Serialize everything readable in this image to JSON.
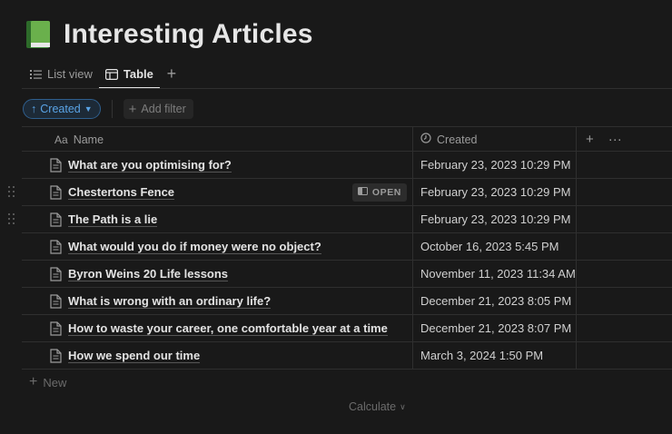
{
  "page": {
    "title": "Interesting Articles",
    "icon": "green-book-icon"
  },
  "tabs": [
    {
      "label": "List view",
      "icon": "list-icon",
      "active": false
    },
    {
      "label": "Table",
      "icon": "table-icon",
      "active": true
    }
  ],
  "filters": {
    "sort_label": "Created",
    "add_filter_label": "Add filter"
  },
  "table": {
    "columns": {
      "name": {
        "label": "Name",
        "icon": "text-aa-icon"
      },
      "created": {
        "label": "Created",
        "icon": "clock-icon"
      }
    },
    "rows": [
      {
        "name": "What are you optimising for?",
        "created": "February 23, 2023 10:29 PM"
      },
      {
        "name": "Chestertons Fence",
        "created": "February 23, 2023 10:29 PM"
      },
      {
        "name": "The Path is a lie",
        "created": "February 23, 2023 10:29 PM"
      },
      {
        "name": "What would you do if money were no object?",
        "created": "October 16, 2023 5:45 PM"
      },
      {
        "name": "Byron Weins 20 Life lessons",
        "created": "November 11, 2023 11:34 AM"
      },
      {
        "name": "What is wrong with an ordinary life?",
        "created": "December 21, 2023 8:05 PM"
      },
      {
        "name": "How to waste your career, one comfortable year at a time",
        "created": "December 21, 2023 8:07 PM"
      },
      {
        "name": "How we spend our time",
        "created": "March 3, 2024 1:50 PM"
      }
    ],
    "open_label": "OPEN",
    "new_label": "New",
    "calculate_label": "Calculate"
  },
  "colors": {
    "background": "#191919",
    "accent": "#5aa4e6",
    "book_green": "#4caf50"
  }
}
